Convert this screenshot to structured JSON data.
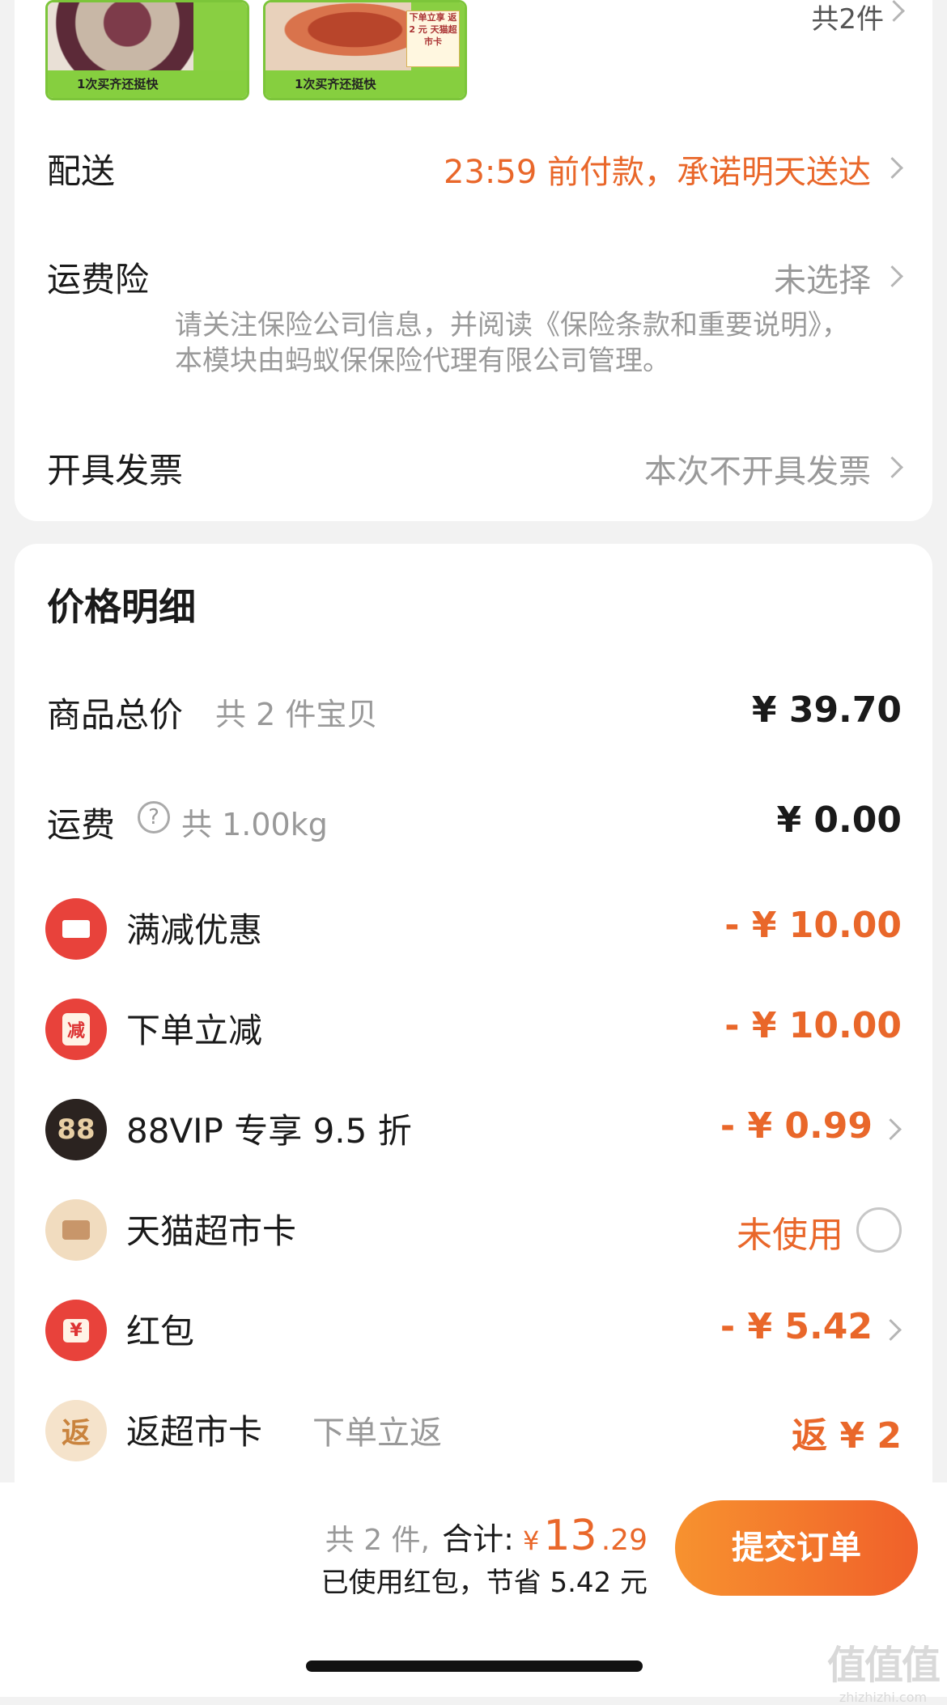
{
  "products": {
    "thumb1_caption": "1次买齐还挺快",
    "thumb2_caption": "1次买齐还挺快",
    "thumb2_badge": "下单立享 返 2 元 天猫超市卡",
    "count": "共2件"
  },
  "delivery": {
    "label": "配送",
    "value": "23:59 前付款，承诺明天送达"
  },
  "insurance": {
    "label": "运费险",
    "value": "未选择",
    "note": "请关注保险公司信息，并阅读《保险条款和重要说明》，本模块由蚂蚁保保险代理有限公司管理。"
  },
  "invoice": {
    "label": "开具发票",
    "value": "本次不开具发票"
  },
  "price_detail": {
    "title": "价格明细",
    "goods_total": {
      "label": "商品总价",
      "sub": "共 2 件宝贝",
      "value": "¥ 39.70"
    },
    "shipping": {
      "label": "运费",
      "sub": "共 1.00kg",
      "value": "¥ 0.00"
    },
    "items": [
      {
        "label": "满减优惠",
        "sub": "",
        "value": "- ¥ 10.00",
        "icon": "ticket-icon",
        "icon_text": "",
        "color": "#e8423b"
      },
      {
        "label": "下单立减",
        "sub": "",
        "value": "- ¥ 10.00",
        "icon": "discount-icon",
        "icon_text": "减",
        "color": "#e8423b"
      },
      {
        "label": "88VIP 专享 9.5 折",
        "sub": "",
        "value": "- ¥ 0.99",
        "icon": "vip88-icon",
        "icon_text": "88",
        "color": "#2b2320"
      },
      {
        "label": "天猫超市卡",
        "sub": "",
        "value": "未使用",
        "icon": "card-icon",
        "icon_text": "",
        "color": "#e8c9a0"
      },
      {
        "label": "红包",
        "sub": "",
        "value": "- ¥ 5.42",
        "icon": "red-packet-icon",
        "icon_text": "¥",
        "color": "#e8423b"
      },
      {
        "label": "返超市卡",
        "sub": "下单立返",
        "value": "返 ¥ 2",
        "icon": "return-icon",
        "icon_text": "返",
        "color": "#f3dcc0"
      }
    ]
  },
  "bottom": {
    "count_text": "共 2 件,",
    "total_label": "合计:",
    "currency": "¥",
    "total_int": "13",
    "total_dec": ".29",
    "saved_text": "已使用红包，节省 5.42 元",
    "submit": "提交订单"
  },
  "watermark": {
    "text": "值值值",
    "site": "zhizhizhi.com"
  }
}
